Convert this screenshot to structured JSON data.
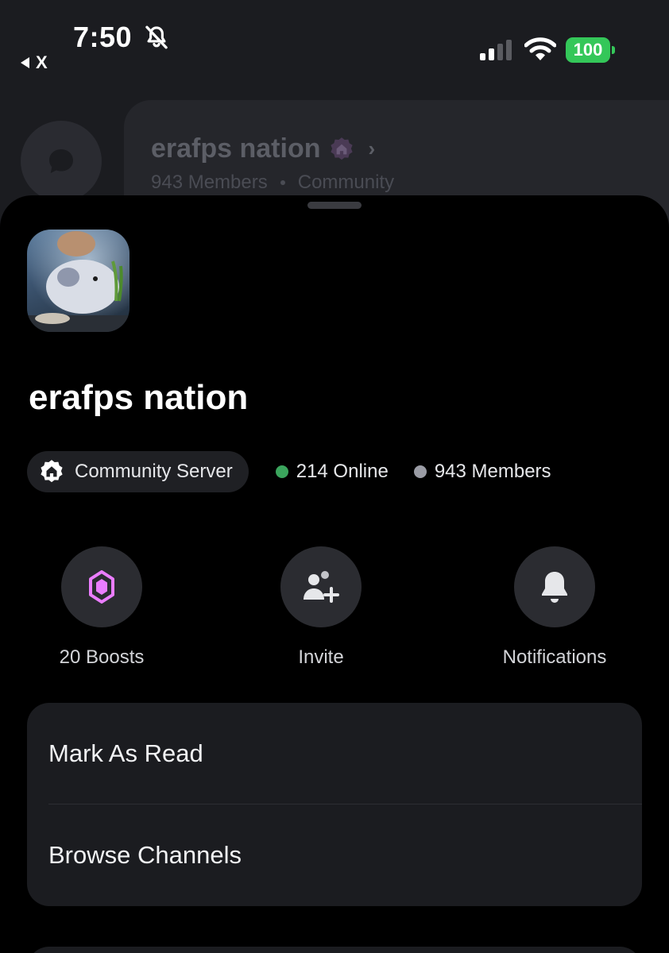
{
  "status_bar": {
    "time": "7:50",
    "back_label": "X",
    "battery": "100"
  },
  "background": {
    "server_title": "erafps nation",
    "members": "943 Members",
    "tag": "Community"
  },
  "server": {
    "name": "erafps nation",
    "community_label": "Community Server",
    "online": "214 Online",
    "members": "943 Members"
  },
  "actions": {
    "boosts": "20 Boosts",
    "invite": "Invite",
    "notifications": "Notifications"
  },
  "menu": {
    "mark_as_read": "Mark As Read",
    "browse_channels": "Browse Channels"
  },
  "colors": {
    "online": "#3ba55d",
    "boost": "#eb7dff",
    "battery": "#34c759"
  }
}
